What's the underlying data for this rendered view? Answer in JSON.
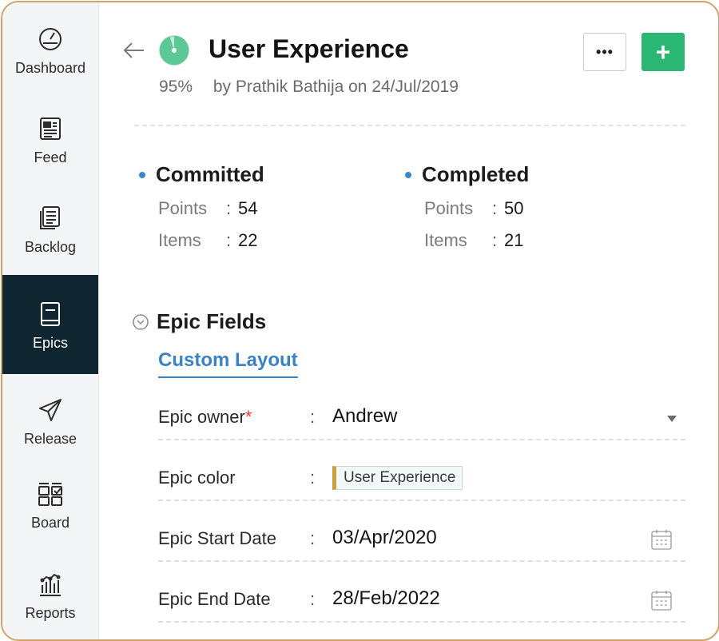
{
  "sidebar": {
    "items": [
      {
        "label": "Dashboard",
        "icon": "gauge-icon",
        "active": false
      },
      {
        "label": "Feed",
        "icon": "feed-icon",
        "active": false
      },
      {
        "label": "Backlog",
        "icon": "backlog-icon",
        "active": false
      },
      {
        "label": "Epics",
        "icon": "epic-book-icon",
        "active": true
      },
      {
        "label": "Release",
        "icon": "paper-plane-icon",
        "active": false
      },
      {
        "label": "Board",
        "icon": "board-icon",
        "active": false
      },
      {
        "label": "Reports",
        "icon": "reports-icon",
        "active": false
      }
    ],
    "active_bg": "#0f2530"
  },
  "header": {
    "title": "User Experience",
    "percent": "95%",
    "progress": 0.95,
    "byline": "by Prathik Bathija on 24/Jul/2019",
    "more_label": "•••",
    "add_label": "+",
    "accent": "#2bb673"
  },
  "stats": {
    "committed": {
      "title": "Committed",
      "points_label": "Points",
      "points": "54",
      "items_label": "Items",
      "items": "22"
    },
    "completed": {
      "title": "Completed",
      "points_label": "Points",
      "points": "50",
      "items_label": "Items",
      "items": "21"
    }
  },
  "epic_fields": {
    "title": "Epic Fields",
    "tab": "Custom Layout",
    "fields": [
      {
        "label": "Epic owner",
        "required_mark": "*",
        "value": "Andrew"
      },
      {
        "label": "Epic color",
        "value": "User Experience"
      },
      {
        "label": "Epic Start Date",
        "value": "03/Apr/2020"
      },
      {
        "label": "Epic End Date",
        "value": "28/Feb/2022"
      }
    ],
    "colon": ":"
  }
}
